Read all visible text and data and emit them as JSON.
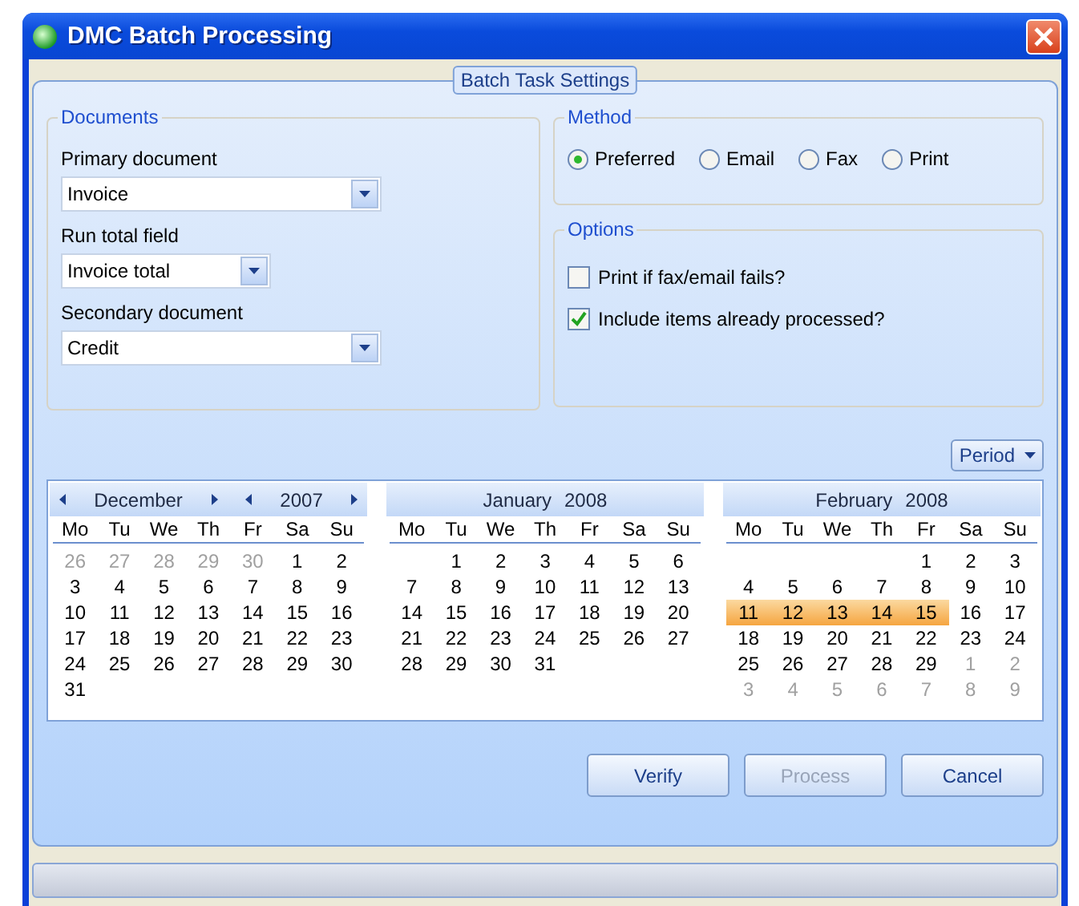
{
  "window": {
    "title": "DMC Batch Processing"
  },
  "panel": {
    "title": "Batch Task Settings"
  },
  "documents": {
    "title": "Documents",
    "fields": [
      {
        "label": "Primary document",
        "value": "Invoice",
        "kind": "wide"
      },
      {
        "label": "Run total field",
        "value": "Invoice total",
        "kind": "short"
      },
      {
        "label": "Secondary document",
        "value": "Credit",
        "kind": "wide"
      }
    ]
  },
  "method": {
    "title": "Method",
    "options": [
      {
        "label": "Preferred",
        "selected": true
      },
      {
        "label": "Email",
        "selected": false
      },
      {
        "label": "Fax",
        "selected": false
      },
      {
        "label": "Print",
        "selected": false
      }
    ]
  },
  "options": {
    "title": "Options",
    "items": [
      {
        "label": "Print if fax/email fails?",
        "checked": false
      },
      {
        "label": "Include items already processed?",
        "checked": true
      }
    ]
  },
  "period_button": {
    "label": "Period"
  },
  "calendar": {
    "months": [
      {
        "month": "December",
        "year": "2007",
        "nav": true,
        "weekdays": [
          "Mo",
          "Tu",
          "We",
          "Th",
          "Fr",
          "Sa",
          "Su"
        ],
        "weeks": [
          {
            "kind": "full",
            "days": [
              {
                "d": "26",
                "muted": true,
                "selected": false
              },
              {
                "d": "27",
                "muted": true,
                "selected": false
              },
              {
                "d": "28",
                "muted": true,
                "selected": false
              },
              {
                "d": "29",
                "muted": true,
                "selected": false
              },
              {
                "d": "30",
                "muted": true,
                "selected": false
              },
              {
                "d": "1",
                "muted": false,
                "selected": false
              },
              {
                "d": "2",
                "muted": false,
                "selected": false
              }
            ]
          },
          {
            "kind": "full",
            "days": [
              {
                "d": "3",
                "muted": false,
                "selected": false
              },
              {
                "d": "4",
                "muted": false,
                "selected": false
              },
              {
                "d": "5",
                "muted": false,
                "selected": false
              },
              {
                "d": "6",
                "muted": false,
                "selected": false
              },
              {
                "d": "7",
                "muted": false,
                "selected": false
              },
              {
                "d": "8",
                "muted": false,
                "selected": false
              },
              {
                "d": "9",
                "muted": false,
                "selected": false
              }
            ]
          },
          {
            "kind": "full",
            "days": [
              {
                "d": "10",
                "muted": false,
                "selected": false
              },
              {
                "d": "11",
                "muted": false,
                "selected": false
              },
              {
                "d": "12",
                "muted": false,
                "selected": false
              },
              {
                "d": "13",
                "muted": false,
                "selected": false
              },
              {
                "d": "14",
                "muted": false,
                "selected": false
              },
              {
                "d": "15",
                "muted": false,
                "selected": false
              },
              {
                "d": "16",
                "muted": false,
                "selected": false
              }
            ]
          },
          {
            "kind": "full",
            "days": [
              {
                "d": "17",
                "muted": false,
                "selected": false
              },
              {
                "d": "18",
                "muted": false,
                "selected": false
              },
              {
                "d": "19",
                "muted": false,
                "selected": false
              },
              {
                "d": "20",
                "muted": false,
                "selected": false
              },
              {
                "d": "21",
                "muted": false,
                "selected": false
              },
              {
                "d": "22",
                "muted": false,
                "selected": false
              },
              {
                "d": "23",
                "muted": false,
                "selected": false
              }
            ]
          },
          {
            "kind": "full",
            "days": [
              {
                "d": "24",
                "muted": false,
                "selected": false
              },
              {
                "d": "25",
                "muted": false,
                "selected": false
              },
              {
                "d": "26",
                "muted": false,
                "selected": false
              },
              {
                "d": "27",
                "muted": false,
                "selected": false
              },
              {
                "d": "28",
                "muted": false,
                "selected": false
              },
              {
                "d": "29",
                "muted": false,
                "selected": false
              },
              {
                "d": "30",
                "muted": false,
                "selected": false
              }
            ]
          },
          {
            "kind": "full",
            "days": [
              {
                "d": "31",
                "muted": false,
                "selected": false
              }
            ]
          }
        ]
      },
      {
        "month": "January",
        "year": "2008",
        "nav": false,
        "weekdays": [
          "Mo",
          "Tu",
          "We",
          "Th",
          "Fr",
          "Sa",
          "Su"
        ],
        "weeks": [
          {
            "kind": "lead",
            "days": [
              {
                "d": "1",
                "muted": false,
                "selected": false
              },
              {
                "d": "2",
                "muted": false,
                "selected": false
              },
              {
                "d": "3",
                "muted": false,
                "selected": false
              },
              {
                "d": "4",
                "muted": false,
                "selected": false
              },
              {
                "d": "5",
                "muted": false,
                "selected": false
              },
              {
                "d": "6",
                "muted": false,
                "selected": false
              }
            ]
          },
          {
            "kind": "full",
            "days": [
              {
                "d": "7",
                "muted": false,
                "selected": false
              },
              {
                "d": "8",
                "muted": false,
                "selected": false
              },
              {
                "d": "9",
                "muted": false,
                "selected": false
              },
              {
                "d": "10",
                "muted": false,
                "selected": false
              },
              {
                "d": "11",
                "muted": false,
                "selected": false
              },
              {
                "d": "12",
                "muted": false,
                "selected": false
              },
              {
                "d": "13",
                "muted": false,
                "selected": false
              }
            ]
          },
          {
            "kind": "full",
            "days": [
              {
                "d": "14",
                "muted": false,
                "selected": false
              },
              {
                "d": "15",
                "muted": false,
                "selected": false
              },
              {
                "d": "16",
                "muted": false,
                "selected": false
              },
              {
                "d": "17",
                "muted": false,
                "selected": false
              },
              {
                "d": "18",
                "muted": false,
                "selected": false
              },
              {
                "d": "19",
                "muted": false,
                "selected": false
              },
              {
                "d": "20",
                "muted": false,
                "selected": false
              }
            ]
          },
          {
            "kind": "full",
            "days": [
              {
                "d": "21",
                "muted": false,
                "selected": false
              },
              {
                "d": "22",
                "muted": false,
                "selected": false
              },
              {
                "d": "23",
                "muted": false,
                "selected": false
              },
              {
                "d": "24",
                "muted": false,
                "selected": false
              },
              {
                "d": "25",
                "muted": false,
                "selected": false
              },
              {
                "d": "26",
                "muted": false,
                "selected": false
              },
              {
                "d": "27",
                "muted": false,
                "selected": false
              }
            ]
          },
          {
            "kind": "full",
            "days": [
              {
                "d": "28",
                "muted": false,
                "selected": false
              },
              {
                "d": "29",
                "muted": false,
                "selected": false
              },
              {
                "d": "30",
                "muted": false,
                "selected": false
              },
              {
                "d": "31",
                "muted": false,
                "selected": false
              }
            ]
          }
        ]
      },
      {
        "month": "February",
        "year": "2008",
        "nav": false,
        "weekdays": [
          "Mo",
          "Tu",
          "We",
          "Th",
          "Fr",
          "Sa",
          "Su"
        ],
        "weeks": [
          {
            "kind": "lead",
            "days": [
              {
                "d": "1",
                "muted": false,
                "selected": false
              },
              {
                "d": "2",
                "muted": false,
                "selected": false
              },
              {
                "d": "3",
                "muted": false,
                "selected": false
              }
            ]
          },
          {
            "kind": "full",
            "days": [
              {
                "d": "4",
                "muted": false,
                "selected": false
              },
              {
                "d": "5",
                "muted": false,
                "selected": false
              },
              {
                "d": "6",
                "muted": false,
                "selected": false
              },
              {
                "d": "7",
                "muted": false,
                "selected": false
              },
              {
                "d": "8",
                "muted": false,
                "selected": false
              },
              {
                "d": "9",
                "muted": false,
                "selected": false
              },
              {
                "d": "10",
                "muted": false,
                "selected": false
              }
            ]
          },
          {
            "kind": "full",
            "days": [
              {
                "d": "11",
                "muted": false,
                "selected": true
              },
              {
                "d": "12",
                "muted": false,
                "selected": true
              },
              {
                "d": "13",
                "muted": false,
                "selected": true
              },
              {
                "d": "14",
                "muted": false,
                "selected": true
              },
              {
                "d": "15",
                "muted": false,
                "selected": true
              },
              {
                "d": "16",
                "muted": false,
                "selected": false
              },
              {
                "d": "17",
                "muted": false,
                "selected": false
              }
            ]
          },
          {
            "kind": "full",
            "days": [
              {
                "d": "18",
                "muted": false,
                "selected": false
              },
              {
                "d": "19",
                "muted": false,
                "selected": false
              },
              {
                "d": "20",
                "muted": false,
                "selected": false
              },
              {
                "d": "21",
                "muted": false,
                "selected": false
              },
              {
                "d": "22",
                "muted": false,
                "selected": false
              },
              {
                "d": "23",
                "muted": false,
                "selected": false
              },
              {
                "d": "24",
                "muted": false,
                "selected": false
              }
            ]
          },
          {
            "kind": "full",
            "days": [
              {
                "d": "25",
                "muted": false,
                "selected": false
              },
              {
                "d": "26",
                "muted": false,
                "selected": false
              },
              {
                "d": "27",
                "muted": false,
                "selected": false
              },
              {
                "d": "28",
                "muted": false,
                "selected": false
              },
              {
                "d": "29",
                "muted": false,
                "selected": false
              },
              {
                "d": "1",
                "muted": true,
                "selected": false
              },
              {
                "d": "2",
                "muted": true,
                "selected": false
              }
            ]
          },
          {
            "kind": "full",
            "days": [
              {
                "d": "3",
                "muted": true,
                "selected": false
              },
              {
                "d": "4",
                "muted": true,
                "selected": false
              },
              {
                "d": "5",
                "muted": true,
                "selected": false
              },
              {
                "d": "6",
                "muted": true,
                "selected": false
              },
              {
                "d": "7",
                "muted": true,
                "selected": false
              },
              {
                "d": "8",
                "muted": true,
                "selected": false
              },
              {
                "d": "9",
                "muted": true,
                "selected": false
              }
            ]
          }
        ]
      }
    ]
  },
  "buttons": [
    {
      "label": "Verify",
      "disabled": false
    },
    {
      "label": "Process",
      "disabled": true
    },
    {
      "label": "Cancel",
      "disabled": false
    }
  ]
}
